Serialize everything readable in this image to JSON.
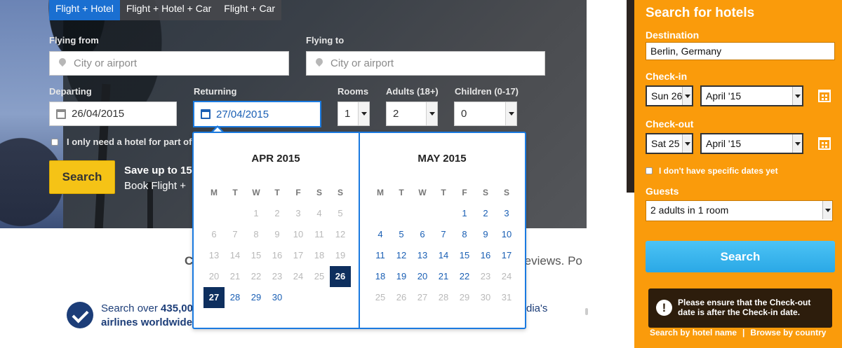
{
  "tabs": [
    "Flight + Hotel",
    "Flight + Hotel + Car",
    "Flight + Car"
  ],
  "flying_from": {
    "label": "Flying from",
    "placeholder": "City or airport"
  },
  "flying_to": {
    "label": "Flying to",
    "placeholder": "City or airport"
  },
  "departing": {
    "label": "Departing",
    "value": "26/04/2015"
  },
  "returning": {
    "label": "Returning",
    "value": "27/04/2015"
  },
  "rooms": {
    "label": "Rooms",
    "value": "1"
  },
  "adults": {
    "label": "Adults (18+)",
    "value": "2"
  },
  "children": {
    "label": "Children (0-17)",
    "value": "0"
  },
  "partial_hotel_label": "I only need a hotel for part of",
  "search_label": "Search",
  "promo": {
    "line1": "Save up to 15",
    "line2": "Book Flight +"
  },
  "lower": {
    "left_fragment": "C",
    "right_fragment": "reviews. Po",
    "search_over": "Search over",
    "count": "435,00",
    "airlines": "airlines worldwide",
    "dias": "dia's"
  },
  "datepicker": {
    "weekdays": [
      "M",
      "T",
      "W",
      "T",
      "F",
      "S",
      "S"
    ],
    "months": [
      {
        "title": "APR 2015",
        "days": [
          {
            "d": "",
            "s": "blank"
          },
          {
            "d": "",
            "s": "blank"
          },
          {
            "d": "1",
            "s": "dis"
          },
          {
            "d": "2",
            "s": "dis"
          },
          {
            "d": "3",
            "s": "dis"
          },
          {
            "d": "4",
            "s": "dis"
          },
          {
            "d": "5",
            "s": "dis"
          },
          {
            "d": "6",
            "s": "dis"
          },
          {
            "d": "7",
            "s": "dis"
          },
          {
            "d": "8",
            "s": "dis"
          },
          {
            "d": "9",
            "s": "dis"
          },
          {
            "d": "10",
            "s": "dis"
          },
          {
            "d": "11",
            "s": "dis"
          },
          {
            "d": "12",
            "s": "dis"
          },
          {
            "d": "13",
            "s": "dis"
          },
          {
            "d": "14",
            "s": "dis"
          },
          {
            "d": "15",
            "s": "dis"
          },
          {
            "d": "16",
            "s": "dis"
          },
          {
            "d": "17",
            "s": "dis"
          },
          {
            "d": "18",
            "s": "dis"
          },
          {
            "d": "19",
            "s": "dis"
          },
          {
            "d": "20",
            "s": "dis"
          },
          {
            "d": "21",
            "s": "dis"
          },
          {
            "d": "22",
            "s": "dis"
          },
          {
            "d": "23",
            "s": "dis"
          },
          {
            "d": "24",
            "s": "dis"
          },
          {
            "d": "25",
            "s": "dis"
          },
          {
            "d": "26",
            "s": "sel"
          },
          {
            "d": "27",
            "s": "sel"
          },
          {
            "d": "28",
            "s": "act"
          },
          {
            "d": "29",
            "s": "act"
          },
          {
            "d": "30",
            "s": "act"
          }
        ]
      },
      {
        "title": "MAY 2015",
        "days": [
          {
            "d": "",
            "s": "blank"
          },
          {
            "d": "",
            "s": "blank"
          },
          {
            "d": "",
            "s": "blank"
          },
          {
            "d": "",
            "s": "blank"
          },
          {
            "d": "1",
            "s": "act"
          },
          {
            "d": "2",
            "s": "act"
          },
          {
            "d": "3",
            "s": "act"
          },
          {
            "d": "4",
            "s": "act"
          },
          {
            "d": "5",
            "s": "act"
          },
          {
            "d": "6",
            "s": "act"
          },
          {
            "d": "7",
            "s": "act"
          },
          {
            "d": "8",
            "s": "act"
          },
          {
            "d": "9",
            "s": "act"
          },
          {
            "d": "10",
            "s": "act"
          },
          {
            "d": "11",
            "s": "act"
          },
          {
            "d": "12",
            "s": "act"
          },
          {
            "d": "13",
            "s": "act"
          },
          {
            "d": "14",
            "s": "act"
          },
          {
            "d": "15",
            "s": "act"
          },
          {
            "d": "16",
            "s": "act"
          },
          {
            "d": "17",
            "s": "act"
          },
          {
            "d": "18",
            "s": "act"
          },
          {
            "d": "19",
            "s": "act"
          },
          {
            "d": "20",
            "s": "act"
          },
          {
            "d": "21",
            "s": "act"
          },
          {
            "d": "22",
            "s": "act"
          },
          {
            "d": "23",
            "s": "dis"
          },
          {
            "d": "24",
            "s": "dis"
          },
          {
            "d": "25",
            "s": "dis"
          },
          {
            "d": "26",
            "s": "dis"
          },
          {
            "d": "27",
            "s": "dis"
          },
          {
            "d": "28",
            "s": "dis"
          },
          {
            "d": "29",
            "s": "dis"
          },
          {
            "d": "30",
            "s": "dis"
          },
          {
            "d": "31",
            "s": "dis"
          }
        ]
      }
    ]
  },
  "hotel_panel": {
    "title": "Search for hotels",
    "destination_label": "Destination",
    "destination_value": "Berlin, Germany",
    "checkin_label": "Check-in",
    "checkin_day": "Sun 26",
    "checkin_month": "April '15",
    "checkout_label": "Check-out",
    "checkout_day": "Sat 25",
    "checkout_month": "April '15",
    "no_dates_label": "I don't have specific dates yet",
    "guests_label": "Guests",
    "guests_value": "2 adults in 1 room",
    "search_label": "Search",
    "alert_icon": "!",
    "alert_text": "Please ensure that the Check-out date is after the Check-in date.",
    "link_name": "Search by hotel name",
    "link_sep": "|",
    "link_country": "Browse by country"
  },
  "colors": {
    "accent": "#1a7ae0",
    "panel": "#fa9b0b",
    "button": "#f5c316",
    "selected_day": "#0e2f5e"
  }
}
